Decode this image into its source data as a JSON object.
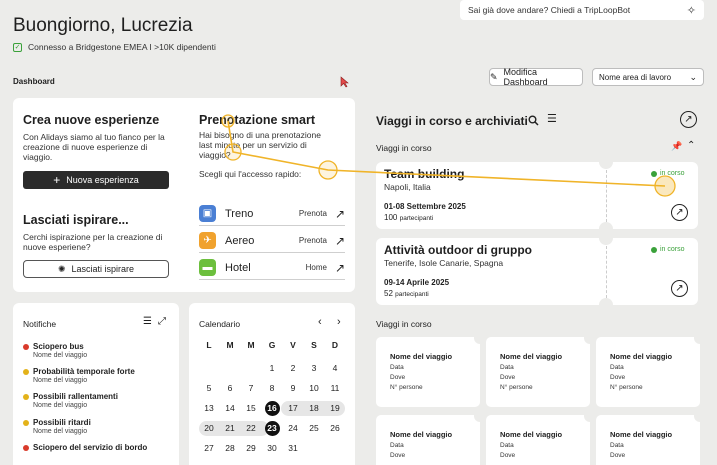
{
  "header": {
    "greeting": "Buongiorno, Lucrezia",
    "connection": "Connesso a Bridgestone EMEA I >10K dipendenti",
    "ai_placeholder": "Sai già dove andare? Chiedi a TripLoopBot"
  },
  "toolbar": {
    "section": "Dashboard",
    "edit_label": "Modifica Dashboard",
    "workspace_placeholder": "Nome area di lavoro"
  },
  "create": {
    "title": "Crea nuove esperienze",
    "text": "Con Alidays siamo al tuo fianco per la creazione di nuove esperienze di viaggio.",
    "button": "Nuova esperienza"
  },
  "inspire": {
    "title": "Lasciati ispirare...",
    "text": "Cerchi ispirazione per la creazione di nuove esperiene?",
    "button": "Lasciati ispirare"
  },
  "booking": {
    "title": "Prenotazione smart",
    "text": "Hai bisogno di una prenotazione last minute per un servizio di viaggio?",
    "quick": "Scegli qui l'accesso rapido:",
    "services": [
      {
        "name": "Treno",
        "action": "Prenota",
        "color": "#4a7fd4"
      },
      {
        "name": "Aereo",
        "action": "Prenota",
        "color": "#f0a22e"
      },
      {
        "name": "Hotel",
        "action": "Home",
        "color": "#6cbf3d"
      }
    ]
  },
  "trips": {
    "title": "Viaggi in corso e archiviati",
    "section1": "Viaggi in corso",
    "section2": "Viaggi in corso",
    "items": [
      {
        "name": "Team building",
        "place": "Napoli, Italia",
        "dates": "01-08 Settembre 2025",
        "count": "100",
        "count_label": "partecipanti",
        "status": "in corso"
      },
      {
        "name": "Attività outdoor di gruppo",
        "place": "Tenerife, Isole Canarie, Spagna",
        "dates": "09-14 Aprile 2025",
        "count": "52",
        "count_label": "partecipanti",
        "status": "in corso"
      }
    ],
    "mini": {
      "title": "Nome del viaggio",
      "l1": "Data",
      "l2": "Dove",
      "l3": "N° persone"
    }
  },
  "notifications": {
    "title": "Notifiche",
    "items": [
      {
        "title": "Sciopero bus",
        "sub": "Nome del viaggio",
        "color": "#d93a2b"
      },
      {
        "title": "Probabilità temporale forte",
        "sub": "Nome del viaggio",
        "color": "#e3b21a"
      },
      {
        "title": "Possibili rallentamenti",
        "sub": "Nome del viaggio",
        "color": "#e3b21a"
      },
      {
        "title": "Possibili ritardi",
        "sub": "Nome del viaggio",
        "color": "#e3b21a"
      },
      {
        "title": "Sciopero del servizio di bordo",
        "sub": "",
        "color": "#d93a2b"
      }
    ]
  },
  "calendar": {
    "title": "Calendario",
    "weekdays": [
      "L",
      "M",
      "M",
      "G",
      "V",
      "S",
      "D"
    ],
    "weeks": [
      [
        "",
        "",
        "",
        "1",
        "2",
        "3",
        "4"
      ],
      [
        "5",
        "6",
        "7",
        "8",
        "9",
        "10",
        "11"
      ],
      [
        "12",
        "13",
        "14",
        "15",
        "16",
        "17",
        "18",
        "19"
      ],
      [
        "20",
        "21",
        "22",
        "23",
        "24",
        "25",
        "26"
      ],
      [
        "27",
        "28",
        "29",
        "30",
        "31",
        "",
        ""
      ]
    ]
  },
  "colors": {
    "accent": "#f0b429",
    "dark": "#2b2b2b",
    "ok": "#3aa13a"
  }
}
